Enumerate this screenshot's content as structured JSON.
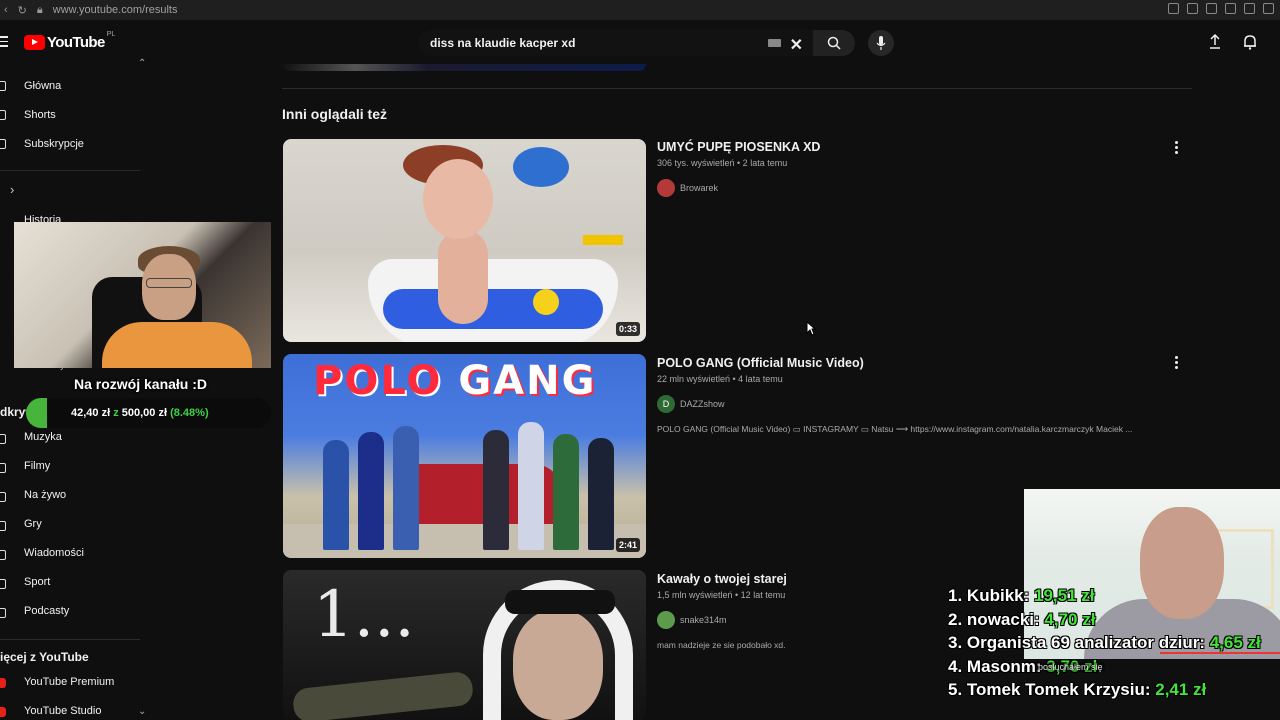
{
  "browser": {
    "url": "www.youtube.com/results"
  },
  "header": {
    "logo_text": "YouTube",
    "country_code": "PL",
    "search_value": "diss na klaudie kacper xd"
  },
  "sidebar": {
    "items_top": [
      {
        "label": "Główna",
        "icon": "home-icon"
      },
      {
        "label": "Shorts",
        "icon": "shorts-icon"
      },
      {
        "label": "Subskrypcje",
        "icon": "subscriptions-icon"
      }
    ],
    "history_label": "Historia",
    "partial_label": "Podkasty",
    "explore_partial": "dkryw",
    "items_explore": [
      {
        "label": "Muzyka",
        "icon": "music-icon"
      },
      {
        "label": "Filmy",
        "icon": "film-icon"
      },
      {
        "label": "Na żywo",
        "icon": "live-icon"
      },
      {
        "label": "Gry",
        "icon": "gaming-icon"
      },
      {
        "label": "Wiadomości",
        "icon": "news-icon"
      },
      {
        "label": "Sport",
        "icon": "trophy-icon"
      },
      {
        "label": "Podcasty",
        "icon": "podcast-icon"
      }
    ],
    "more_heading": "ięcej z YouTube",
    "items_more": [
      {
        "label": "YouTube Premium"
      },
      {
        "label": "YouTube Studio"
      }
    ]
  },
  "donation_goal": {
    "title": "Na rozwój kanału :D",
    "current": "42,40 zł",
    "separator": "z",
    "target": "500,00 zł",
    "percent_text": "(8.48%)",
    "progress": 0.0848,
    "fill_color": "#47b43b"
  },
  "main": {
    "section_title": "Inni oglądali też",
    "videos": [
      {
        "title": "UMYĆ PUPĘ PIOSENKA XD",
        "meta": "306 tys. wyświetleń • 2 lata temu",
        "channel": "Browarek",
        "duration": "0:33",
        "description": ""
      },
      {
        "title": "POLO GANG (Official Music Video)",
        "meta": "22 mln wyświetleń • 4 lata temu",
        "channel": "DAZZshow",
        "duration": "2:41",
        "description": "POLO GANG (Official Music Video) ▭ INSTAGRAMY ▭ Natsu ⟶ https://www.instagram.com/natalia.karczmarczyk Maciek ...",
        "thumb_text_1": "POLO",
        "thumb_text_2": "GANG"
      },
      {
        "title": "Kawały o twojej starej",
        "meta": "1,5 mln wyświetleń • 12 lat temu",
        "channel": "snake314m",
        "duration": "",
        "description": "mam nadzieje ze sie podobało xd.",
        "thumb_text": "1..."
      }
    ]
  },
  "leaderboard": [
    {
      "rank": "1.",
      "name": "Kubikk:",
      "amount": "19,51 zł"
    },
    {
      "rank": "2.",
      "name": "nowacki:",
      "amount": "4,70 zł"
    },
    {
      "rank": "3.",
      "name": "Organista 69 analizator dziur:",
      "amount": "4,65 zł"
    },
    {
      "rank": "4.",
      "name": "Masonm:",
      "amount": "3,70 zł"
    },
    {
      "rank": "5.",
      "name": "Tomek Tomek Krzysiu:",
      "amount": "2,41 zł"
    }
  ],
  "overlay_message": "posłuchałem się",
  "colors": {
    "background": "#0f0f0f",
    "accent_red": "#ff0000",
    "donation_green": "#45e43a"
  }
}
